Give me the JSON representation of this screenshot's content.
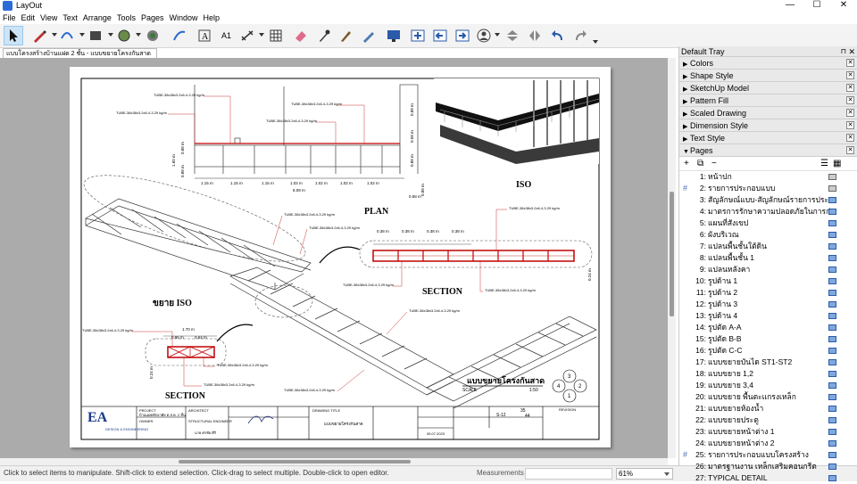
{
  "window": {
    "app_title": "LayOut",
    "controls": [
      "—",
      "☐",
      "✕"
    ]
  },
  "menu": [
    "File",
    "Edit",
    "View",
    "Text",
    "Arrange",
    "Tools",
    "Pages",
    "Window",
    "Help"
  ],
  "document_tab": "แบบโครงสร้างบ้านแฝด 2 ชั้น - แบบขยายโครงกันสาด",
  "drawing": {
    "labels": {
      "plan": "PLAN",
      "iso": "ISO",
      "section1": "SECTION",
      "section2": "SECTION",
      "detail_iso": "ขยาย ISO",
      "sheet_title": "แบบขยายโครงกันสาด",
      "scale_label": "SCALE",
      "scale_value": "1:50"
    },
    "tube_spec": "TUBE-38x38x3.2x6.4-3.29 kg/m",
    "plan_dims": [
      "1.15 m",
      "1.15 m",
      "1.15 m",
      "1.02 m",
      "1.02 m",
      "1.02 m",
      "1.02 m"
    ],
    "plan_total": "8.09 m",
    "plan_vert": [
      "1.60 m",
      "0.88 m",
      "0.88 m"
    ],
    "right_dims": [
      "0.88 m",
      "0.58 m",
      "0.88 m",
      "0.88 m",
      "0.58 m"
    ],
    "section_dims": [
      "0.38 m",
      "0.38 m",
      "0.38 m",
      "0.38 m"
    ],
    "section_h": "0.24 m",
    "detail_dims": [
      "1.70 m",
      "0.96 m",
      "0.64 m"
    ],
    "detail_h": "0.24 m",
    "keyplan": [
      "1",
      "2",
      "3",
      "4"
    ],
    "titleblock": {
      "logo_text": "DESIGN & ENGINEERING",
      "project_label": "PROJECT",
      "project_value": "บ้านแฝดพักอาศัย ต.ส.ค. 2 ชั้น",
      "owner_label": "OWNER",
      "architect_label": "ARCHITECT",
      "structural_label": "STRUCTURAL ENGINEER",
      "engineer_name": "นาย ศรชัย ศิริ",
      "drawing_title_label": "DRAWING TITLE",
      "drawing_title_value": "แบบขยายโครงกันสาด",
      "sheet_no": "S-12",
      "sheet_count": "44",
      "sheet_numbers": "35",
      "revision_label": "REVISION",
      "date": "05.07.2023"
    }
  },
  "status": {
    "message": "Click to select items to manipulate. Shift-click to extend selection. Click-drag to select multiple. Double-click to open editor.",
    "measurements_label": "Measurements",
    "measurements_value": "",
    "zoom": "61%"
  },
  "tray": {
    "title": "Default Tray",
    "sections": [
      "Colors",
      "Shape Style",
      "SketchUp Model",
      "Pattern Fill",
      "Scaled Drawing",
      "Dimension Style",
      "Text Style"
    ],
    "pages_title": "Pages",
    "pages": [
      {
        "num": "1:",
        "name": "หน้าปก",
        "hash": false,
        "icon": "off"
      },
      {
        "num": "2:",
        "name": "รายการประกอบแบบ",
        "hash": true,
        "icon": "off"
      },
      {
        "num": "3:",
        "name": "สัญลักษณ์แบบ-สัญลักษณ์รายการประกอ",
        "hash": false,
        "icon": "on"
      },
      {
        "num": "4:",
        "name": "มาตรการรักษาความปลอดภัยในการก่อ",
        "hash": false,
        "icon": "on"
      },
      {
        "num": "5:",
        "name": "แผนที่สังเขป",
        "hash": false,
        "icon": "on"
      },
      {
        "num": "6:",
        "name": "ผังบริเวณ",
        "hash": false,
        "icon": "on"
      },
      {
        "num": "7:",
        "name": "แปลนพื้นชั้นใต้ดิน",
        "hash": false,
        "icon": "on"
      },
      {
        "num": "8:",
        "name": "แปลนพื้นชั้น 1",
        "hash": false,
        "icon": "on"
      },
      {
        "num": "9:",
        "name": "แปลนหลังคา",
        "hash": false,
        "icon": "on"
      },
      {
        "num": "10:",
        "name": "รูปด้าน 1",
        "hash": false,
        "icon": "on"
      },
      {
        "num": "11:",
        "name": "รูปด้าน 2",
        "hash": false,
        "icon": "on"
      },
      {
        "num": "12:",
        "name": "รูปด้าน 3",
        "hash": false,
        "icon": "on"
      },
      {
        "num": "13:",
        "name": "รูปด้าน 4",
        "hash": false,
        "icon": "on"
      },
      {
        "num": "14:",
        "name": "รูปตัด A-A",
        "hash": false,
        "icon": "on"
      },
      {
        "num": "15:",
        "name": "รูปตัด B-B",
        "hash": false,
        "icon": "on"
      },
      {
        "num": "16:",
        "name": "รูปตัด C-C",
        "hash": false,
        "icon": "on"
      },
      {
        "num": "17:",
        "name": "แบบขยายบันได ST1-ST2",
        "hash": false,
        "icon": "on"
      },
      {
        "num": "18:",
        "name": "แบบขยาย 1,2",
        "hash": false,
        "icon": "on"
      },
      {
        "num": "19:",
        "name": "แบบขยาย 3,4",
        "hash": false,
        "icon": "on"
      },
      {
        "num": "20:",
        "name": "แบบขยาย พื้นตะแกรงเหล็ก",
        "hash": false,
        "icon": "on"
      },
      {
        "num": "21:",
        "name": "แบบขยายห้องน้ำ",
        "hash": false,
        "icon": "on"
      },
      {
        "num": "22:",
        "name": "แบบขยายประตู",
        "hash": false,
        "icon": "on"
      },
      {
        "num": "23:",
        "name": "แบบขยายหน้าต่าง 1",
        "hash": false,
        "icon": "on"
      },
      {
        "num": "24:",
        "name": "แบบขยายหน้าต่าง 2",
        "hash": false,
        "icon": "on"
      },
      {
        "num": "25:",
        "name": "รายการประกอบแบบโครงสร้าง",
        "hash": true,
        "icon": "on"
      },
      {
        "num": "26:",
        "name": "มาตรฐานงาน เหล็กเสริมคอนกรีต",
        "hash": false,
        "icon": "on"
      },
      {
        "num": "27:",
        "name": "TYPICAL DETAIL",
        "hash": false,
        "icon": "on"
      }
    ]
  }
}
